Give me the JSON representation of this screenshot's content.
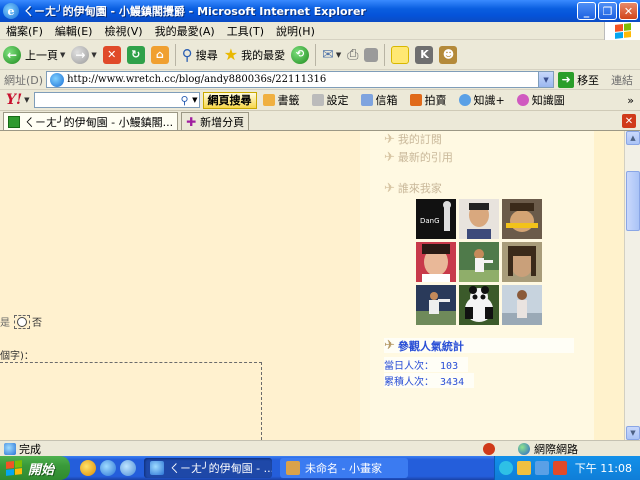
{
  "window": {
    "title": "ㄑㄧㄤ╯的伊甸園 - 小鰻鎮閣攪爵 - Microsoft Internet Explorer"
  },
  "menu": [
    "檔案(F)",
    "編輯(E)",
    "檢視(V)",
    "我的最愛(A)",
    "工具(T)",
    "說明(H)"
  ],
  "toolbar": {
    "back_label": "上一頁",
    "search_label": "搜尋",
    "favorites_label": "我的最愛"
  },
  "address": {
    "label": "網址(D)",
    "url": "http://www.wretch.cc/blog/andy880036s/22111316",
    "go_label": "移至",
    "links_label": "連結"
  },
  "yahoo": {
    "logo": "Y!",
    "search_button": "網頁搜尋",
    "items": [
      "書籤",
      "設定",
      "信箱",
      "拍賣",
      "知識+",
      "知識圖"
    ]
  },
  "tabs": {
    "active": "ㄑㄧㄤ╯的伊甸園 - 小鰻鎮閣...",
    "new_tab": "新增分頁"
  },
  "content": {
    "radio_suffix": "否",
    "radio_prefix": "是",
    "hint": "個字)：",
    "sidebar": {
      "links": [
        "我的訂閱",
        "最新的引用",
        "誰來我家"
      ],
      "stats_title": "參觀人氣統計",
      "today_label": "當日人次：",
      "today_value": "103",
      "total_label": "累積人次：",
      "total_value": "3434",
      "friend_tiles": [
        "friend-1",
        "friend-2",
        "friend-3",
        "friend-4",
        "friend-5",
        "friend-6",
        "friend-7",
        "friend-8",
        "friend-9"
      ]
    }
  },
  "status": {
    "text": "完成",
    "zone": "網際網路"
  },
  "taskbar": {
    "start": "開始",
    "tasks": [
      "ㄑㄧㄤ╯的伊甸園 - ...",
      "未命名 - 小畫家"
    ],
    "clock": "下午 11:08"
  },
  "colors": {
    "content_bg": "#fff7dc",
    "stats_blue": "#2a4fd6",
    "titlebar_blue": "#0553d9"
  }
}
